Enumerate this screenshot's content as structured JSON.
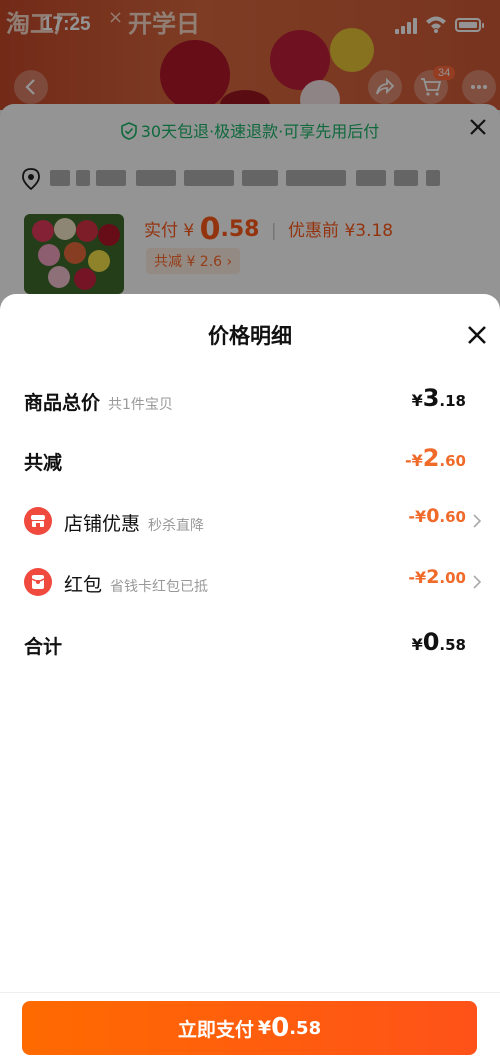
{
  "status_bar": {
    "time": "17:25"
  },
  "background": {
    "banner_left": "淘工厂",
    "banner_sep": "×",
    "banner_right": "开学日",
    "cart_count": "34",
    "promo": "30天包退·极速退款·可享先用后付",
    "paid_label": "实付",
    "paid_currency": "¥",
    "paid_int": "0",
    "paid_dec": ".58",
    "before_discount": "优惠前 ¥3.18",
    "reduce_tag": "共减 ¥ 2.6 ›"
  },
  "sheet": {
    "title": "价格明细",
    "rows": {
      "total": {
        "label": "商品总价",
        "sub": "共1件宝贝",
        "currency": "¥",
        "int": "3",
        "dec": ".18"
      },
      "reduced": {
        "label": "共减",
        "currency": "-¥",
        "int": "2",
        "dec": ".60"
      },
      "shop": {
        "label": "店铺优惠",
        "sub": "秒杀直降",
        "currency": "-¥",
        "int": "0",
        "dec": ".60"
      },
      "redpacket": {
        "label": "红包",
        "sub": "省钱卡红包已抵",
        "currency": "-¥",
        "int": "2",
        "dec": ".00"
      },
      "sum": {
        "label": "合计",
        "currency": "¥",
        "int": "0",
        "dec": ".58"
      }
    },
    "pay_button": {
      "label": "立即支付",
      "currency": "¥",
      "int": "0",
      "dec": ".58"
    }
  },
  "colors": {
    "accent": "#ff5a1a",
    "discount": "#f06a2a",
    "icon_red": "#f0493e",
    "promo_green": "#1ab56a"
  }
}
